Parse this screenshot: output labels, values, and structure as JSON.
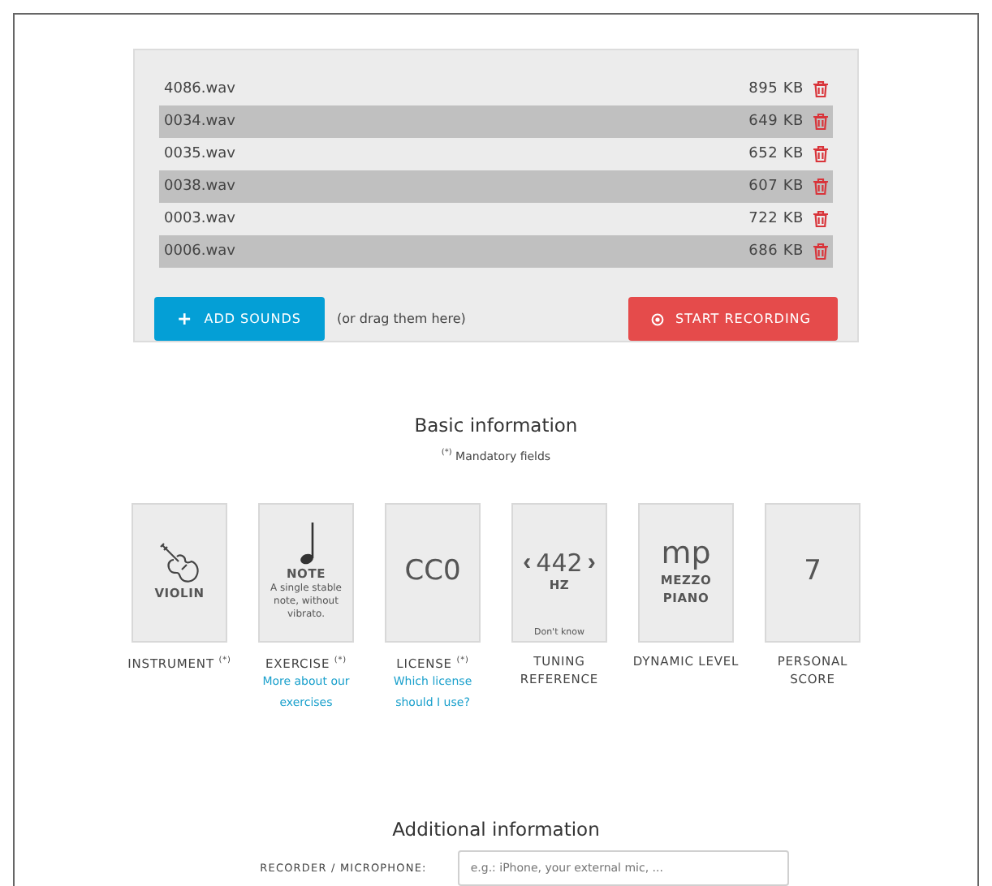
{
  "files": [
    {
      "name": "4086.wav",
      "size": "895 KB"
    },
    {
      "name": "0034.wav",
      "size": "649 KB"
    },
    {
      "name": "0035.wav",
      "size": "652 KB"
    },
    {
      "name": "0038.wav",
      "size": "607 KB"
    },
    {
      "name": "0003.wav",
      "size": "722 KB"
    },
    {
      "name": "0006.wav",
      "size": "686 KB"
    }
  ],
  "add_button": {
    "icon": "+",
    "label": "ADD SOUNDS"
  },
  "drag_hint": "(or drag them here)",
  "record_button": {
    "label": "START RECORDING"
  },
  "basic": {
    "title": "Basic information",
    "mandatory": "$^{(*)}$ Mandatory fields",
    "cards": [
      {
        "kind": "violin",
        "caption": "VIOLIN",
        "label": "INSTRUMENT $^{(*)}$"
      },
      {
        "kind": "note",
        "caption": "NOTE",
        "detail": "A single stable note, without vibrato.",
        "label": "EXERCISE $^{(*)}$",
        "link": "More about our exercises"
      },
      {
        "kind": "big",
        "value": "CC0",
        "label": "LICENSE $^{(*)}$",
        "link": "Which license should I use?"
      },
      {
        "kind": "tuning",
        "prev": "‹",
        "value": "442",
        "next": "›",
        "unit": "HZ",
        "footer": "Don't know",
        "label": "TUNING REFERENCE"
      },
      {
        "kind": "big",
        "value": "mp",
        "caption": "MEZZO PIANO",
        "label": "DYNAMIC LEVEL"
      },
      {
        "kind": "big",
        "value": "7",
        "label": "PERSONAL SCORE"
      }
    ]
  },
  "additional": {
    "title": "Additional information",
    "fields": [
      {
        "label": "RECORDER / MICROPHONE:",
        "placeholder": "e.g.: iPhone, your external mic, ..."
      }
    ]
  }
}
